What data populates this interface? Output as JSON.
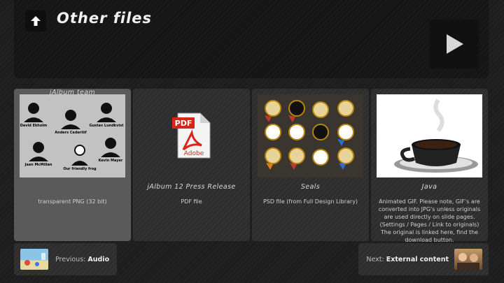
{
  "header": {
    "title": "Other files"
  },
  "tiles": [
    {
      "title": "jAlbum team",
      "desc": "transparent PNG (32 bit)"
    },
    {
      "title": "jAlbum 12 Press Release",
      "desc": "PDF file"
    },
    {
      "title": "Seals",
      "desc": "PSD file (from Full Design Library)"
    },
    {
      "title": "Java",
      "desc": "Animated GIF. Please note, GIF's are converted into JPG's unless originals are used directly on slide pages. (Settings / Pages / Link to originals) The original is linked here, find the download button."
    }
  ],
  "team_names": [
    "David Ekholm",
    "Anders Cederlöf",
    "Gustav Lundkvist",
    "Jaan McMillan",
    "Our friendly frog",
    "Kevin Mayer"
  ],
  "pdf_icon": {
    "badge": "PDF",
    "brand": "Adobe"
  },
  "nav": {
    "previous_prefix": "Previous:",
    "previous_label": "Audio",
    "next_prefix": "Next:",
    "next_label": "External content"
  },
  "colors": {
    "accent_pdf": "#d8251c",
    "background": "#1d1d1d",
    "tile": "#2d2d2d",
    "tile_active": "#5a5a5a"
  }
}
